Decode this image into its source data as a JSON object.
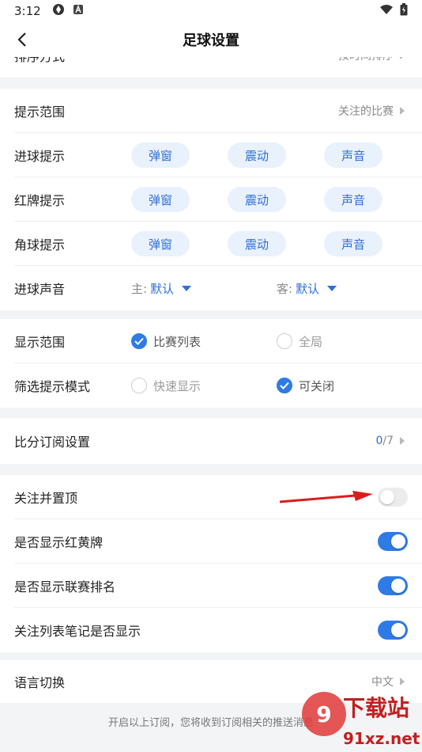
{
  "status_bar": {
    "time": "3:12"
  },
  "app_bar": {
    "title": "足球设置"
  },
  "partial_row": {
    "label": "排序方式",
    "value": "按时间排序"
  },
  "alert_scope": {
    "label": "提示范围",
    "value": "关注的比赛"
  },
  "alert_options": {
    "popup": "弹窗",
    "vibrate": "震动",
    "sound": "声音"
  },
  "alert_rows": [
    {
      "label": "进球提示"
    },
    {
      "label": "红牌提示"
    },
    {
      "label": "角球提示"
    }
  ],
  "goal_sound": {
    "label": "进球声音",
    "home_label": "主:",
    "home_value": "默认",
    "away_label": "客:",
    "away_value": "默认"
  },
  "display_scope": {
    "label": "显示范围",
    "option_a": "比赛列表",
    "option_a_checked": true,
    "option_b": "全局",
    "option_b_checked": false
  },
  "filter_mode": {
    "label": "筛选提示模式",
    "option_a": "快速显示",
    "option_a_checked": false,
    "option_b": "可关闭",
    "option_b_checked": true
  },
  "score_subscription": {
    "label": "比分订阅设置",
    "current": "0",
    "total": "/7"
  },
  "toggles": [
    {
      "label": "关注并置顶",
      "on": false
    },
    {
      "label": "是否显示红黄牌",
      "on": true
    },
    {
      "label": "是否显示联赛排名",
      "on": true
    },
    {
      "label": "关注列表笔记是否显示",
      "on": true
    }
  ],
  "language": {
    "label": "语言切换",
    "value": "中文"
  },
  "footer_note": "开启以上订阅，您将收到订阅相关的推送消息",
  "watermark": {
    "brand": "下载站",
    "domain": "91xz.net"
  },
  "colors": {
    "accent": "#2f7be6",
    "pill_bg": "#e9f1fd",
    "page_bg": "#f3f4f6"
  }
}
